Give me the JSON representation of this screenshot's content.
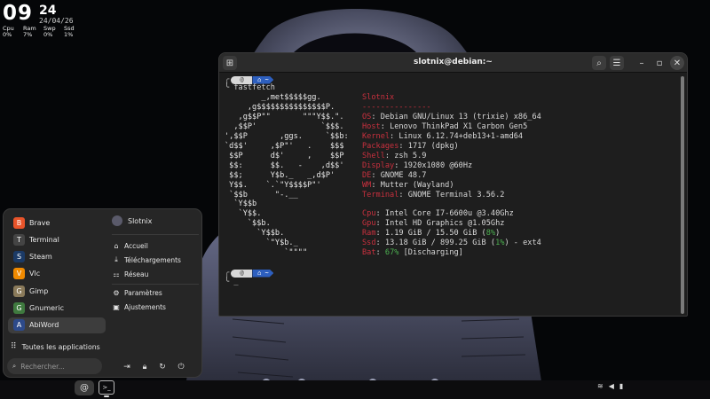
{
  "conky": {
    "hour": "09",
    "minute": "24",
    "date": "24/04/26",
    "stats": [
      {
        "label": "Cpu",
        "value": "0%"
      },
      {
        "label": "Ram",
        "value": "7%"
      },
      {
        "label": "Swp",
        "value": "0%"
      },
      {
        "label": "Ssd",
        "value": "1%"
      }
    ]
  },
  "terminal": {
    "title": "slotnix@debian:~",
    "command": "fastfetch",
    "prompt_dir_icon": "⌂ ~",
    "cursor": "_",
    "ascii": [
      "        _,met$$$$$gg.",
      "     ,g$$$$$$$$$$$$$$$P.",
      "   ,g$$P\"\"       \"\"\"Y$$.\".",
      "  ,$$P'              `$$$.",
      "',$$P       ,ggs.     `$$b:",
      "`d$$'     ,$P\"'   .    $$$",
      " $$P      d$'     ,    $$P",
      " $$:      $$.   -    ,d$$'",
      " $$;      Y$b._   _,d$P'",
      " Y$$.    `.`\"Y$$$$P\"'",
      " `$$b      \"-.__",
      "  `Y$$b",
      "   `Y$$.",
      "     `$$b.",
      "       `Y$$b.",
      "         `\"Y$b._",
      "             `\"\"\"\""
    ],
    "host_name": "Slotnix",
    "separator": "---------------",
    "info": [
      {
        "key": "OS",
        "value": "Debian GNU/Linux 13 (trixie) x86_64"
      },
      {
        "key": "Host",
        "value": "Lenovo ThinkPad X1 Carbon Gen5"
      },
      {
        "key": "Kernel",
        "value": "Linux 6.12.74+deb13+1-amd64"
      },
      {
        "key": "Packages",
        "value": "1717 (dpkg)"
      },
      {
        "key": "Shell",
        "value": "zsh 5.9"
      },
      {
        "key": "Display",
        "value": "1920x1080 @60Hz"
      },
      {
        "key": "DE",
        "value": "GNOME 48.7"
      },
      {
        "key": "WM",
        "value": "Mutter (Wayland)"
      },
      {
        "key": "Terminal",
        "value": "GNOME Terminal 3.56.2"
      }
    ],
    "info2": [
      {
        "key": "Cpu",
        "value": "Intel Core I7-6600u @3.40Ghz"
      },
      {
        "key": "Gpu",
        "value": "Intel HD Graphics @1.05Ghz"
      }
    ],
    "ram": {
      "key": "Ram",
      "value": "1.19 GiB / 15.50 GiB (",
      "pct": "8%",
      "tail": ")"
    },
    "ssd": {
      "key": "Ssd",
      "value": "13.18 GiB / 899.25 GiB (",
      "pct": "1%",
      "tail": ") - ext4"
    },
    "bat": {
      "key": "Bat",
      "pct": "67%",
      "value": " [Discharging]"
    }
  },
  "menu": {
    "apps": [
      {
        "label": "Brave",
        "icon": "brave-icon",
        "color": "#e8542a"
      },
      {
        "label": "Terminal",
        "icon": "terminal-icon",
        "color": "#444444"
      },
      {
        "label": "Steam",
        "icon": "steam-icon",
        "color": "#1b3a66"
      },
      {
        "label": "Vlc",
        "icon": "vlc-icon",
        "color": "#f08a00"
      },
      {
        "label": "Gimp",
        "icon": "gimp-icon",
        "color": "#8a7a5a"
      },
      {
        "label": "Gnumeric",
        "icon": "gnumeric-icon",
        "color": "#3f7a3f"
      },
      {
        "label": "AbiWord",
        "icon": "abiword-icon",
        "color": "#2d4a8a"
      }
    ],
    "user": "Slotnix",
    "places": [
      {
        "label": "Accueil",
        "icon": "home-icon"
      },
      {
        "label": "Téléchargements",
        "icon": "download-icon"
      },
      {
        "label": "Réseau",
        "icon": "network-icon"
      }
    ],
    "system": [
      {
        "label": "Paramètres",
        "icon": "gear-icon"
      },
      {
        "label": "Ajustements",
        "icon": "tweaks-icon"
      }
    ],
    "all_apps": "Toutes les applications",
    "search_placeholder": "Rechercher..."
  },
  "colors": {
    "accent": "#c9303e",
    "ok": "#4caf50",
    "prompt_blue": "#2d5fbf"
  }
}
